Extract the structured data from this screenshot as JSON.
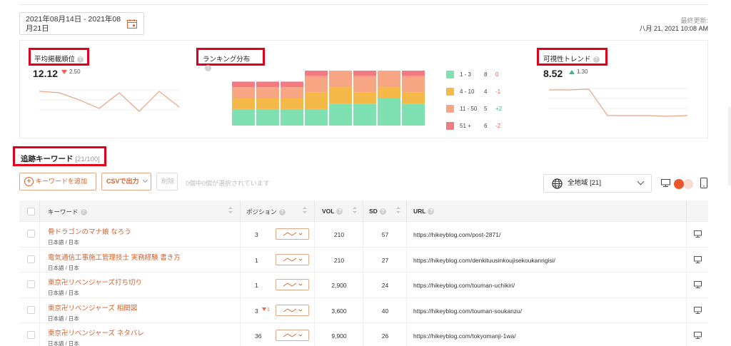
{
  "header": {
    "date_range": "2021年08月14日 - 2021年08月21日",
    "updated_label": "最終更新:",
    "updated_value": "八月 21, 2021 10:08 AM"
  },
  "cards": {
    "avg_rank": {
      "title": "平均掲載順位",
      "value": "12.12",
      "delta": "2.50",
      "delta_dir": "down"
    },
    "ranking_dist": {
      "title": "ランキング分布"
    },
    "visibility": {
      "title": "可視性トレンド",
      "value": "8.52",
      "delta": "1.30",
      "delta_dir": "up"
    }
  },
  "legend": [
    {
      "range": "1 - 3",
      "count": "8",
      "change": "0",
      "color": "#7fe0b1",
      "change_color": "#e8604c"
    },
    {
      "range": "4 - 10",
      "count": "4",
      "change": "-1",
      "color": "#f5b94a",
      "change_color": "#e8604c"
    },
    {
      "range": "11 - 50",
      "count": "5",
      "change": "+2",
      "color": "#f7a583",
      "change_color": "#3cb878"
    },
    {
      "range": "51 +",
      "count": "6",
      "change": "-2",
      "color": "#f47a82",
      "change_color": "#e8604c"
    }
  ],
  "dist_bars": [
    [
      3,
      2,
      2,
      1
    ],
    [
      3,
      2,
      2,
      1
    ],
    [
      3,
      2,
      2,
      1
    ],
    [
      3,
      3,
      3,
      3
    ],
    [
      4,
      3,
      3,
      3
    ],
    [
      4,
      2,
      3,
      3
    ],
    [
      5,
      2,
      3,
      3
    ],
    [
      4,
      2,
      3,
      4
    ]
  ],
  "section": {
    "title": "追跡キーワード",
    "count": "[21/100]"
  },
  "toolbar": {
    "add_label": "キーワードを追加",
    "csv_label": "CSVで出力",
    "delete_label": "削除",
    "selection_msg": "0個中0個が選択されています",
    "region_label": "全地域 [21]"
  },
  "table": {
    "headers": {
      "keyword": "キーワード",
      "position": "ポジション",
      "vol": "VOL",
      "sd": "SD",
      "url": "URL"
    },
    "rows": [
      {
        "keyword": "骨ドラゴンのマナ娘 なろう",
        "lang": "日本語 / 日本",
        "position": "3",
        "pos_delta": "",
        "vol": "210",
        "sd": "57",
        "url": "https://hikeyblog.com/post-2871/"
      },
      {
        "keyword": "電気通信工事施工管理技士 実務経験 書き方",
        "lang": "日本語 / 日本",
        "position": "1",
        "pos_delta": "",
        "vol": "210",
        "sd": "27",
        "url": "https://hikeyblog.com/denkituusinkoujisekoukanrigisi/"
      },
      {
        "keyword": "東京卍リベンジャーズ打ち切り",
        "lang": "日本語 / 日本",
        "position": "1",
        "pos_delta": "",
        "vol": "2,900",
        "sd": "24",
        "url": "https://hikeyblog.com/touman-uchikiri/"
      },
      {
        "keyword": "東京卍リベンジャーズ 相関図",
        "lang": "日本語 / 日本",
        "position": "3",
        "pos_delta": "1",
        "vol": "3,600",
        "sd": "40",
        "url": "https://hikeyblog.com/touman-soukanzu/"
      },
      {
        "keyword": "東京卍リベンジャーズ ネタバレ",
        "lang": "日本語 / 日本",
        "position": "36",
        "pos_delta": "",
        "vol": "9,900",
        "sd": "26",
        "url": "https://hikeyblog.com/tokyomanji-1wa/"
      }
    ]
  }
}
